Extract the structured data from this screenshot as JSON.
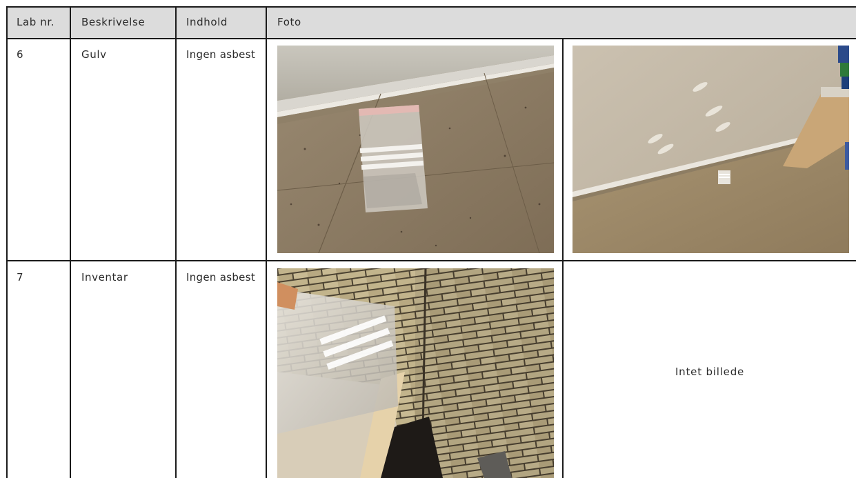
{
  "table": {
    "headers": {
      "lab_nr": "Lab nr.",
      "description": "Beskrivelse",
      "content": "Indhold",
      "photo": "Foto"
    },
    "rows": [
      {
        "lab_nr": "6",
        "description": "Gulv",
        "content": "Ingen asbest",
        "photos": [
          "sample-bag-on-terrazzo-floor",
          "wall-and-floor-with-sample-bag"
        ]
      },
      {
        "lab_nr": "7",
        "description": "Inventar",
        "content": "Ingen asbest",
        "photos": [
          "sample-bag-held-against-brick-wall"
        ],
        "no_photo_text": "Intet billede"
      }
    ]
  },
  "colors": {
    "header_background": "#dcdcdc",
    "grid_lines": "#1a1a1a",
    "text": "#2b2b2b"
  }
}
